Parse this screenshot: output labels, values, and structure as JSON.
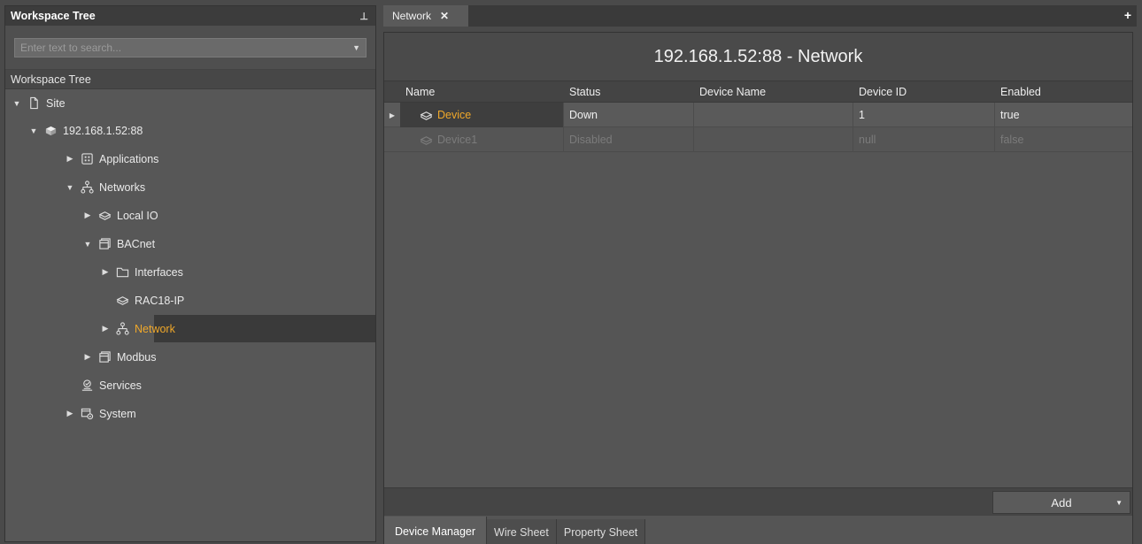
{
  "left_panel": {
    "title": "Workspace Tree",
    "pin_glyph": "⊥",
    "search_placeholder": "Enter text to search...",
    "tree_title": "Workspace Tree",
    "items": [
      {
        "label": "Site",
        "icon": "file-icon",
        "depth": 0,
        "expand": "expanded"
      },
      {
        "label": "192.168.1.52:88",
        "icon": "station-icon",
        "depth": 1,
        "expand": "expanded"
      },
      {
        "label": "Applications",
        "icon": "applications-icon",
        "depth": 2,
        "expand": "collapsed"
      },
      {
        "label": "Networks",
        "icon": "networks-icon",
        "depth": 2,
        "expand": "expanded"
      },
      {
        "label": "Local IO",
        "icon": "device-icon",
        "depth": 3,
        "expand": "collapsed"
      },
      {
        "label": "BACnet",
        "icon": "protocol-icon",
        "depth": 3,
        "expand": "expanded"
      },
      {
        "label": "Interfaces",
        "icon": "folder-icon",
        "depth": 4,
        "expand": "collapsed"
      },
      {
        "label": "RAC18-IP",
        "icon": "device-icon",
        "depth": 4,
        "expand": "none"
      },
      {
        "label": "Network",
        "icon": "networks-icon",
        "depth": 4,
        "expand": "collapsed",
        "selected": true
      },
      {
        "label": "Modbus",
        "icon": "protocol-icon",
        "depth": 3,
        "expand": "collapsed"
      },
      {
        "label": "Services",
        "icon": "services-icon",
        "depth": 2,
        "expand": "none"
      },
      {
        "label": "System",
        "icon": "system-icon",
        "depth": 2,
        "expand": "collapsed"
      }
    ]
  },
  "tabs": {
    "open_tab": "Network",
    "close_glyph": "✕",
    "add_glyph": "+"
  },
  "main": {
    "title": "192.168.1.52:88 - Network",
    "columns": [
      "Name",
      "Status",
      "Device Name",
      "Device ID",
      "Enabled"
    ],
    "rows": [
      {
        "name": "Device",
        "status": "Down",
        "device_name": "",
        "device_id": "1",
        "enabled": "true",
        "state": "active"
      },
      {
        "name": "Device1",
        "status": "Disabled",
        "device_name": "",
        "device_id": "null",
        "enabled": "false",
        "state": "disabled"
      }
    ],
    "add_button": "Add",
    "view_tabs": [
      "Device Manager",
      "Wire Sheet",
      "Property Sheet"
    ],
    "active_view": "Device Manager"
  },
  "colors": {
    "accent": "#f0a82a",
    "panel_bg": "#575757",
    "header_bg": "#3c3c3c"
  }
}
